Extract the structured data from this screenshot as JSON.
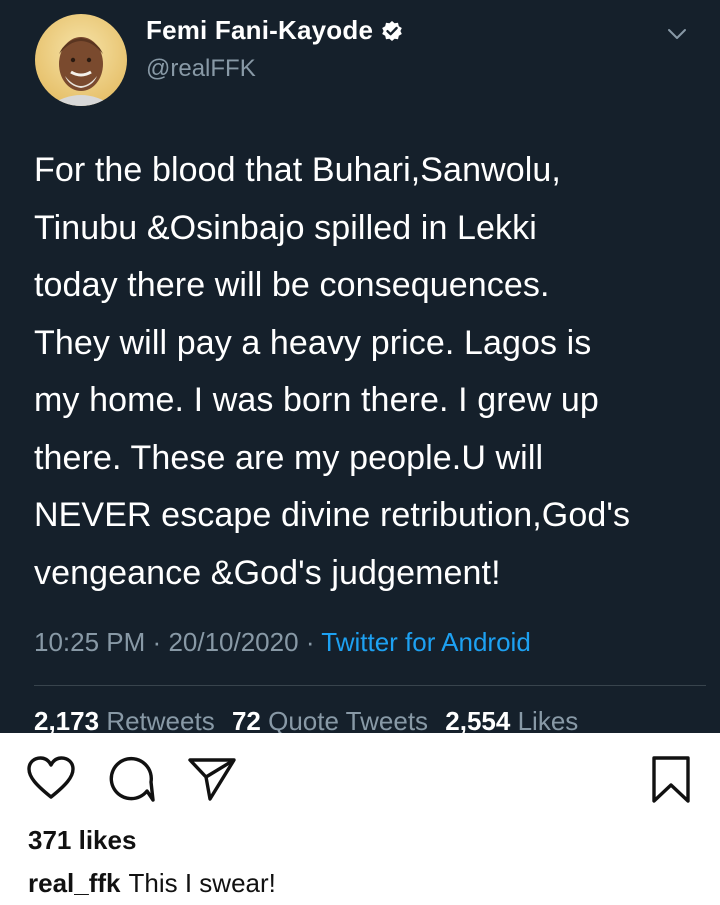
{
  "tweet": {
    "author_name": "Femi Fani-Kayode",
    "handle": "@realFFK",
    "verified": true,
    "text": "For the blood that Buhari,Sanwolu,\nTinubu &Osinbajo spilled in Lekki\ntoday there will be consequences.\nThey will pay a heavy price. Lagos is\nmy home. I was born there. I grew up\nthere. These are my people.U will\nNEVER escape divine retribution,God's\nvengeance &God's judgement!",
    "time": "10:25 PM",
    "date": "20/10/2020",
    "separator": "·",
    "source": "Twitter for Android",
    "stats": {
      "retweets": "2,173",
      "retweets_label": "Retweets",
      "quote_tweets": "72",
      "quote_tweets_label": "Quote Tweets",
      "likes": "2,554",
      "likes_label": "Likes"
    },
    "colors": {
      "background": "#15202b",
      "secondary_text": "#8899a6",
      "link": "#1da1f2"
    }
  },
  "instagram": {
    "likes": "371 likes",
    "caption_user": "real_ffk",
    "caption_text": "This I swear!",
    "icons": [
      "heart-icon",
      "comment-icon",
      "share-icon",
      "bookmark-icon"
    ]
  }
}
